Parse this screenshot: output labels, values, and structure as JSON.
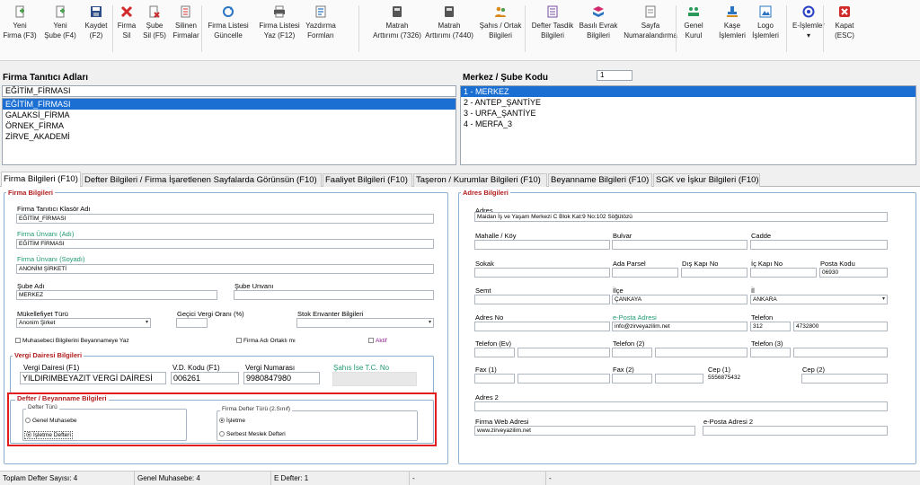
{
  "toolbar": {
    "buttons": [
      {
        "line1": "Yeni",
        "line2": "Firma (F3)",
        "icon": "new-document-icon",
        "color": "#4aa34a"
      },
      {
        "line1": "Yeni",
        "line2": "Şube (F4)",
        "icon": "new-branch-icon",
        "color": "#4aa34a"
      },
      {
        "line1": "Kaydet",
        "line2": "(F2)",
        "icon": "save-icon",
        "color": "#2d4e8a"
      },
      {
        "line1": "Firma",
        "line2": "Sil",
        "icon": "delete-icon",
        "color": "#d12a2a"
      },
      {
        "line1": "Şube",
        "line2": "Sil (F5)",
        "icon": "delete-branch-icon",
        "color": "#d12a2a"
      },
      {
        "line1": "Silinen",
        "line2": "Firmalar",
        "icon": "deleted-list-icon",
        "color": "#d12a2a"
      },
      {
        "line1": "Firma Listesi",
        "line2": "Güncelle",
        "icon": "refresh-icon",
        "color": "#2a74c2"
      },
      {
        "line1": "Firma Listesi",
        "line2": "Yaz (F12)",
        "icon": "printer-icon",
        "color": "#555555"
      },
      {
        "line1": "Yazdırma",
        "line2": "Formları",
        "icon": "print-forms-icon",
        "color": "#2a74c2"
      },
      {
        "line1": "Matrah",
        "line2": "Arttırımı (7326)",
        "icon": "book-icon",
        "color": "#555555"
      },
      {
        "line1": "Matrah",
        "line2": "Arttırımı (7440)",
        "icon": "book-icon",
        "color": "#555555"
      },
      {
        "line1": "Şahıs / Ortak",
        "line2": "Bilgileri",
        "icon": "people-icon",
        "color": "#d88a1a"
      },
      {
        "line1": "Defter Tasdik",
        "line2": "Bilgileri",
        "icon": "ledger-icon",
        "color": "#7a4aa0"
      },
      {
        "line1": "Basılı Evrak",
        "line2": "Bilgileri",
        "icon": "printed-docs-icon",
        "color": "#d12a6a"
      },
      {
        "line1": "Sayfa",
        "line2": "Numaralandırma",
        "icon": "page-number-icon",
        "color": "#666666"
      },
      {
        "line1": "Genel",
        "line2": "Kurul",
        "icon": "meeting-icon",
        "color": "#2a9a5a"
      },
      {
        "line1": "Kaşe",
        "line2": "İşlemleri",
        "icon": "stamp-icon",
        "color": "#2a74c2"
      },
      {
        "line1": "Logo",
        "line2": "İşlemleri",
        "icon": "logo-icon",
        "color": "#2a74c2"
      },
      {
        "line1": "E-İşlemler",
        "line2": "▾",
        "icon": "e-operations-icon",
        "color": "#2a40c2"
      },
      {
        "line1": "Kapat",
        "line2": "(ESC)",
        "icon": "close-icon",
        "color": "#d12a2a"
      }
    ]
  },
  "firm_panel": {
    "title": "Firma Tanıtıcı Adları",
    "search_value": "EĞİTİM_FİRMASI",
    "items": [
      "EĞİTİM_FİRMASI",
      "GALAKSİ_FİRMA",
      "ÖRNEK_FİRMA",
      "ZİRVE_AKADEMİ"
    ]
  },
  "branch_panel": {
    "title": "Merkez / Şube Kodu",
    "code_value": "1",
    "items": [
      "1 - MERKEZ",
      "2 - ANTEP_ŞANTİYE",
      "3 - URFA_ŞANTİYE",
      "4 - MERFA_3"
    ]
  },
  "tabs": [
    "Firma Bilgileri (F10)",
    "Defter Bilgileri / Firma İşaretlenen Sayfalarda Görünsün (F10)",
    "Faaliyet Bilgileri (F10)",
    "Taşeron / Kurumlar Bilgileri (F10)",
    "Beyanname Bilgileri (F10)",
    "SGK ve İşkur Bilgileri (F10)"
  ],
  "firma": {
    "group_title": "Firma Bilgileri",
    "klasor_label": "Firma Tanıtıcı Klasör Adı",
    "klasor_value": "EĞİTİM_FİRMASI",
    "unvan_adi_label": "Firma Ünvanı (Adı)",
    "unvan_adi_value": "EĞİTİM FİRMASI",
    "unvan_soyadi_label": "Firma Ünvanı (Soyadı)",
    "unvan_soyadi_value": "ANONİM ŞİRKETİ",
    "sube_adi_label": "Şube Adı",
    "sube_adi_value": "MERKEZ",
    "sube_unvani_label": "Şube Unvanı",
    "sube_unvani_value": "",
    "mukellefiyet_label": "Mükellefiyet Türü",
    "mukellefiyet_value": "Anonim Şirket",
    "gecici_label": "Geçici Vergi Oranı (%)",
    "gecici_value": "",
    "stok_label": "Stok Envanter Bilgileri",
    "stok_value": "",
    "muhasebeci_label": "Muhasebeci Bilgilerini Beyannameye Yaz",
    "ortakli_label": "Firma Adı Ortaklı mı",
    "aktif_label": "Aktif"
  },
  "vergi": {
    "group_title": "Vergi Dairesi Bilgileri",
    "daire_label": "Vergi Dairesi (F1)",
    "daire_value": "YILDIRIMBEYAZIT VERGİ DAİRESİ",
    "kodu_label": "V.D. Kodu (F1)",
    "kodu_value": "006261",
    "numara_label": "Vergi Numarası",
    "numara_value": "9980847980",
    "tc_label": "Şahıs İse T.C. No",
    "tc_value": ""
  },
  "defter": {
    "group_title": "Defter / Beyanname Bilgileri",
    "turu_title": "Defter Türü",
    "genel_label": "Genel Muhasebe",
    "isletme_label": "İşletme Defteri",
    "firma_turu_title": "Firma Defter Türü (2.Sınıf)",
    "isletme_option": "İşletme",
    "serbest_option": "Serbest Meslek Defteri"
  },
  "adres": {
    "group_title": "Adres Bilgileri",
    "adres_label": "Adres",
    "adres_value": "Maidan İş ve Yaşam Merkezi C Blok Kat:9 No:102 Söğütözü",
    "mahalle_label": "Mahalle / Köy",
    "bulvar_label": "Bulvar",
    "cadde_label": "Cadde",
    "sokak_label": "Sokak",
    "ada_label": "Ada Parsel",
    "dis_kapi_label": "Dış Kapı No",
    "ic_kapi_label": "İç Kapı No",
    "posta_label": "Posta Kodu",
    "posta_value": "06930",
    "semt_label": "Semt",
    "ilce_label": "İlçe",
    "ilce_value": "ÇANKAYA",
    "il_label": "İl",
    "il_value": "ANKARA",
    "adres_no_label": "Adres No",
    "eposta_label": "e-Posta Adresi",
    "eposta_value": "info@zirveyazilim.net",
    "telefon_label": "Telefon",
    "tel_code_value": "312",
    "tel_value": "4732800",
    "tel_ev_label": "Telefon (Ev)",
    "tel2_label": "Telefon (2)",
    "tel3_label": "Telefon (3)",
    "fax1_label": "Fax (1)",
    "fax2_label": "Fax (2)",
    "cep1_label": "Cep (1)",
    "cep1_value": "5556875432",
    "cep2_label": "Cep (2)",
    "adres2_label": "Adres 2",
    "web_label": "Firma Web Adresi",
    "web_value": "www.zirveyazilim.net",
    "eposta2_label": "e-Posta Adresi 2"
  },
  "status": {
    "toplam": "Toplam Defter Sayısı: 4",
    "genel": "Genel Muhasebe: 4",
    "edefter": "E Defter: 1",
    "dash1": "-",
    "dash2": "-"
  },
  "colors": {
    "selection": "#1b6fd2",
    "group_title": "#b11d1d",
    "highlight_box": "#e11d1d",
    "label_green": "#1e9a6d"
  }
}
